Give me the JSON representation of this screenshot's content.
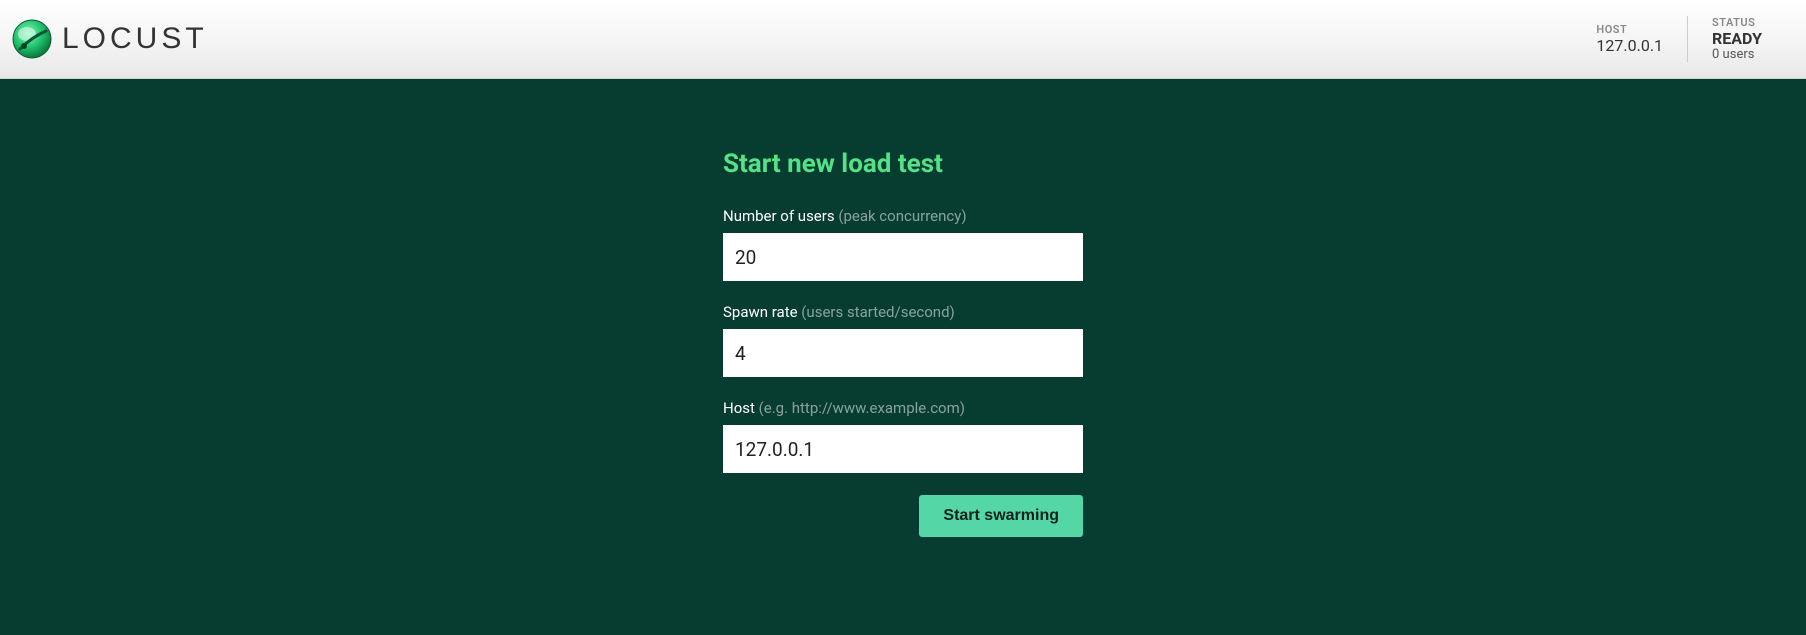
{
  "brand": {
    "name": "LOCUST"
  },
  "header": {
    "host_label": "HOST",
    "host_value": "127.0.0.1",
    "status_label": "STATUS",
    "status_value": "READY",
    "status_sub": "0 users"
  },
  "form": {
    "title": "Start new load test",
    "users_label": "Number of users ",
    "users_hint": "(peak concurrency)",
    "users_value": "20",
    "spawn_label": "Spawn rate ",
    "spawn_hint": "(users started/second)",
    "spawn_value": "4",
    "host_label": "Host ",
    "host_hint": "(e.g. http://www.example.com)",
    "host_value": "127.0.0.1",
    "submit_label": "Start swarming"
  }
}
